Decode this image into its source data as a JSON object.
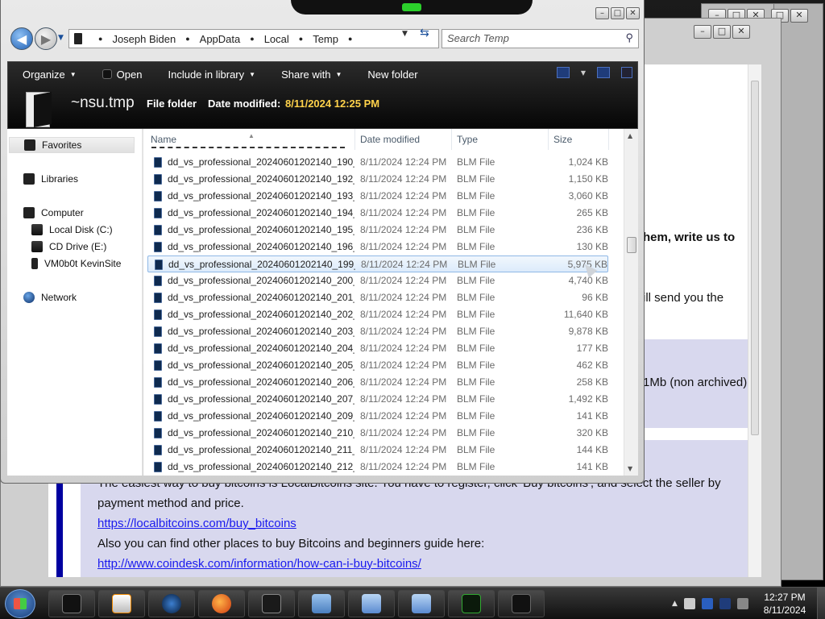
{
  "explorer": {
    "breadcrumbs": [
      "Joseph Biden",
      "AppData",
      "Local",
      "Temp"
    ],
    "search_placeholder": "Search Temp",
    "toolbar": {
      "organize": "Organize",
      "open": "Open",
      "include_in_library": "Include in library",
      "share_with": "Share with",
      "new_folder": "New folder"
    },
    "details": {
      "name": "~nsu.tmp",
      "type": "File folder",
      "modified_label": "Date modified:",
      "modified_value": "8/11/2024 12:25 PM"
    },
    "nav": {
      "favorites": "Favorites",
      "libraries": "Libraries",
      "computer": "Computer",
      "local_disk": "Local Disk (C:)",
      "cd_drive": "CD Drive (E:)",
      "share": "VM0b0t KevinSite",
      "network": "Network"
    },
    "columns": {
      "name": "Name",
      "date": "Date modified",
      "type": "Type",
      "size": "Size"
    },
    "files": [
      {
        "name": "dd_vs_professional_20240601202140_190_...",
        "date": "8/11/2024 12:24 PM",
        "type": "BLM File",
        "size": "1,024 KB"
      },
      {
        "name": "dd_vs_professional_20240601202140_192_...",
        "date": "8/11/2024 12:24 PM",
        "type": "BLM File",
        "size": "1,150 KB"
      },
      {
        "name": "dd_vs_professional_20240601202140_193_...",
        "date": "8/11/2024 12:24 PM",
        "type": "BLM File",
        "size": "3,060 KB"
      },
      {
        "name": "dd_vs_professional_20240601202140_194_...",
        "date": "8/11/2024 12:24 PM",
        "type": "BLM File",
        "size": "265 KB"
      },
      {
        "name": "dd_vs_professional_20240601202140_195_...",
        "date": "8/11/2024 12:24 PM",
        "type": "BLM File",
        "size": "236 KB"
      },
      {
        "name": "dd_vs_professional_20240601202140_196_...",
        "date": "8/11/2024 12:24 PM",
        "type": "BLM File",
        "size": "130 KB"
      },
      {
        "name": "dd_vs_professional_20240601202140_199_...",
        "date": "8/11/2024 12:24 PM",
        "type": "BLM File",
        "size": "5,975 KB",
        "selected": true
      },
      {
        "name": "dd_vs_professional_20240601202140_200_...",
        "date": "8/11/2024 12:24 PM",
        "type": "BLM File",
        "size": "4,740 KB"
      },
      {
        "name": "dd_vs_professional_20240601202140_201_...",
        "date": "8/11/2024 12:24 PM",
        "type": "BLM File",
        "size": "96 KB"
      },
      {
        "name": "dd_vs_professional_20240601202140_202_...",
        "date": "8/11/2024 12:24 PM",
        "type": "BLM File",
        "size": "11,640 KB"
      },
      {
        "name": "dd_vs_professional_20240601202140_203_...",
        "date": "8/11/2024 12:24 PM",
        "type": "BLM File",
        "size": "9,878 KB"
      },
      {
        "name": "dd_vs_professional_20240601202140_204_...",
        "date": "8/11/2024 12:24 PM",
        "type": "BLM File",
        "size": "177 KB"
      },
      {
        "name": "dd_vs_professional_20240601202140_205_...",
        "date": "8/11/2024 12:24 PM",
        "type": "BLM File",
        "size": "462 KB"
      },
      {
        "name": "dd_vs_professional_20240601202140_206_...",
        "date": "8/11/2024 12:24 PM",
        "type": "BLM File",
        "size": "258 KB"
      },
      {
        "name": "dd_vs_professional_20240601202140_207_...",
        "date": "8/11/2024 12:24 PM",
        "type": "BLM File",
        "size": "1,492 KB"
      },
      {
        "name": "dd_vs_professional_20240601202140_209_...",
        "date": "8/11/2024 12:24 PM",
        "type": "BLM File",
        "size": "141 KB"
      },
      {
        "name": "dd_vs_professional_20240601202140_210_...",
        "date": "8/11/2024 12:24 PM",
        "type": "BLM File",
        "size": "320 KB"
      },
      {
        "name": "dd_vs_professional_20240601202140_211_...",
        "date": "8/11/2024 12:24 PM",
        "type": "BLM File",
        "size": "144 KB"
      },
      {
        "name": "dd_vs_professional_20240601202140_212_...",
        "date": "8/11/2024 12:24 PM",
        "type": "BLM File",
        "size": "141 KB"
      }
    ]
  },
  "ransom_note": {
    "line1": "hem, write us to",
    "line2": "ill send you the",
    "line3": "1Mb (non archived),",
    "para1": "The easiest way to buy bitcoins is LocalBitcoins site. You have to register, click 'Buy bitcoins', and select the seller by",
    "para2": "payment method and price.",
    "link1": "https://localbitcoins.com/buy_bitcoins",
    "para3": "Also you can find other places to buy Bitcoins and beginners guide here:",
    "link2": "http://www.coindesk.com/information/how-can-i-buy-bitcoins/"
  },
  "taskbar": {
    "time": "12:27 PM",
    "date": "8/11/2024",
    "buttons": [
      "explorer-black",
      "media-player",
      "globe",
      "firefox",
      "monitor",
      "control-panel",
      "network-share",
      "network-share-2",
      "perf-monitor",
      "file-folder"
    ]
  },
  "colors": {
    "accent_yellow": "#ffd24a",
    "ransom_band": "#d8d8ee",
    "ransom_bar": "#0000a0",
    "link": "#1a1aee"
  }
}
